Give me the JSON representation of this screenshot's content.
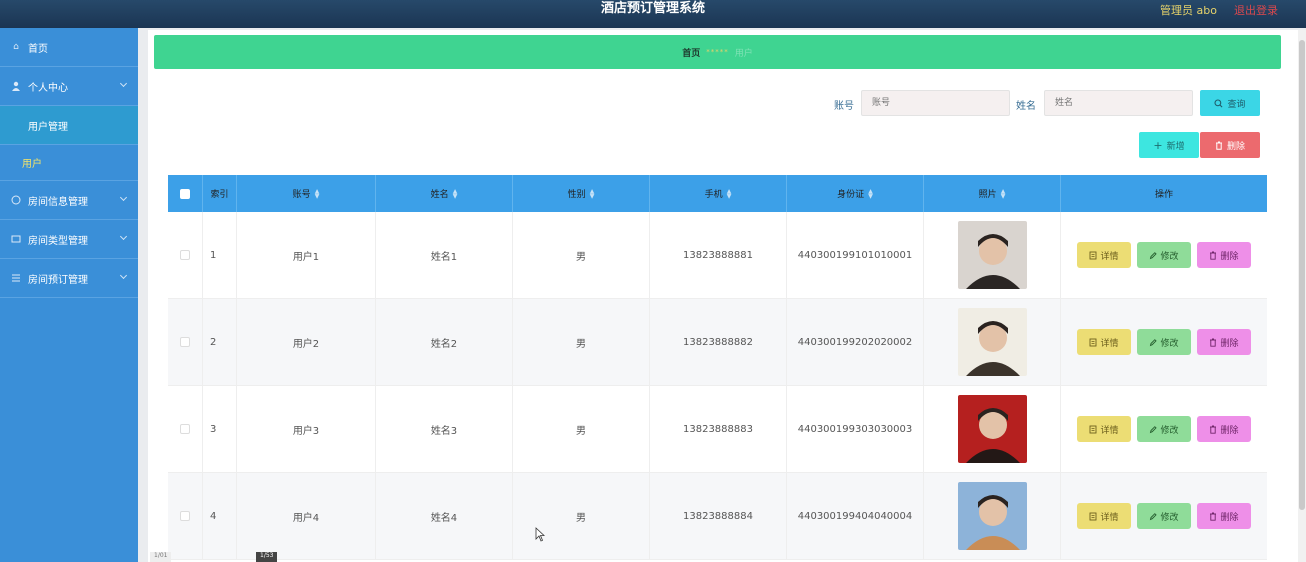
{
  "header": {
    "app_title": "酒店预订管理系统",
    "admin_label": "管理员 abo",
    "logout_label": "退出登录"
  },
  "sidebar": {
    "items": [
      {
        "label": "首页",
        "icon": "home-icon"
      },
      {
        "label": "个人中心",
        "icon": "user-icon"
      },
      {
        "label": "用户管理"
      },
      {
        "label": "用户"
      },
      {
        "label": "房间信息管理",
        "icon": "info-icon"
      },
      {
        "label": "房间类型管理",
        "icon": "category-icon"
      },
      {
        "label": "房间预订管理",
        "icon": "list-icon"
      }
    ]
  },
  "breadcrumb": {
    "home": "首页",
    "stars": "*****",
    "current": "用户"
  },
  "search": {
    "account_label": "账号",
    "account_placeholder": "账号",
    "name_label": "姓名",
    "name_placeholder": "姓名",
    "query_button": "查询"
  },
  "toolbar": {
    "add_button": "新增",
    "delete_button": "删除"
  },
  "table": {
    "headers": {
      "index": "索引",
      "account": "账号",
      "name": "姓名",
      "sex": "性别",
      "phone": "手机",
      "idcard": "身份证",
      "photo": "照片",
      "ops": "操作"
    },
    "rows": [
      {
        "index": "1",
        "account": "用户1",
        "name": "姓名1",
        "sex": "男",
        "phone": "13823888881",
        "idcard": "440300199101010001",
        "photo_colors": [
          "#d9d4cf",
          "#2b2624"
        ]
      },
      {
        "index": "2",
        "account": "用户2",
        "name": "姓名2",
        "sex": "男",
        "phone": "13823888882",
        "idcard": "440300199202020002",
        "photo_colors": [
          "#f0ede4",
          "#3b332b"
        ]
      },
      {
        "index": "3",
        "account": "用户3",
        "name": "姓名3",
        "sex": "男",
        "phone": "13823888883",
        "idcard": "440300199303030003",
        "photo_colors": [
          "#b5201f",
          "#231816"
        ]
      },
      {
        "index": "4",
        "account": "用户4",
        "name": "姓名4",
        "sex": "男",
        "phone": "13823888884",
        "idcard": "440300199404040004",
        "photo_colors": [
          "#8db3d9",
          "#c98d56"
        ]
      }
    ],
    "op_labels": {
      "detail": "详情",
      "edit": "修改",
      "delete": "删除"
    }
  },
  "pager": {
    "left": "1/01",
    "right": "1/53"
  },
  "colors": {
    "sidebar": "#3a8fd8",
    "breadcrumb": "#3fd491",
    "table_header": "#3ca0e8"
  }
}
